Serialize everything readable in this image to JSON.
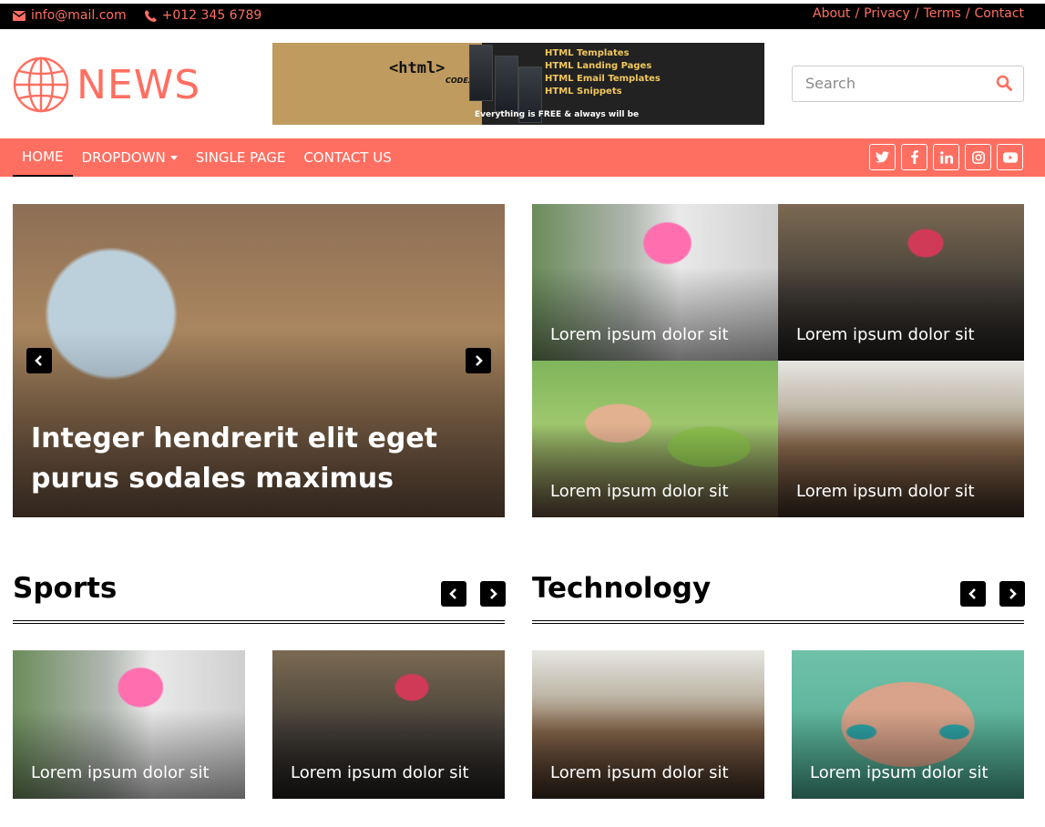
{
  "topbar": {
    "email": "info@mail.com",
    "phone": "+012 345 6789",
    "links": [
      "About",
      "Privacy",
      "Terms",
      "Contact"
    ],
    "separator": "/"
  },
  "header": {
    "logo_text": "NEWS",
    "ad": {
      "tag": "<html>",
      "brand": "CODEX",
      "items": [
        "HTML Templates",
        "HTML Landing Pages",
        "HTML Email Templates",
        "HTML Snippets"
      ],
      "tagline": "Everything is FREE & always will be"
    },
    "search": {
      "placeholder": "Search"
    }
  },
  "nav": {
    "items": [
      "HOME",
      "DROPDOWN",
      "SINGLE PAGE",
      "CONTACT US"
    ],
    "active": "HOME",
    "social_icons": [
      "twitter-icon",
      "facebook-icon",
      "linkedin-icon",
      "instagram-icon",
      "youtube-icon"
    ]
  },
  "hero": {
    "title": "Integer hendrerit elit eget purus sodales maximus"
  },
  "featured_grid": [
    {
      "caption": "Lorem ipsum dolor sit"
    },
    {
      "caption": "Lorem ipsum dolor sit"
    },
    {
      "caption": "Lorem ipsum dolor sit"
    },
    {
      "caption": "Lorem ipsum dolor sit"
    }
  ],
  "sections": [
    {
      "title": "Sports",
      "cards": [
        {
          "caption": "Lorem ipsum dolor sit"
        },
        {
          "caption": "Lorem ipsum dolor sit"
        }
      ]
    },
    {
      "title": "Technology",
      "cards": [
        {
          "caption": "Lorem ipsum dolor sit"
        },
        {
          "caption": "Lorem ipsum dolor sit"
        }
      ]
    }
  ],
  "colors": {
    "accent": "#ff6f61",
    "topbar": "#000000"
  }
}
